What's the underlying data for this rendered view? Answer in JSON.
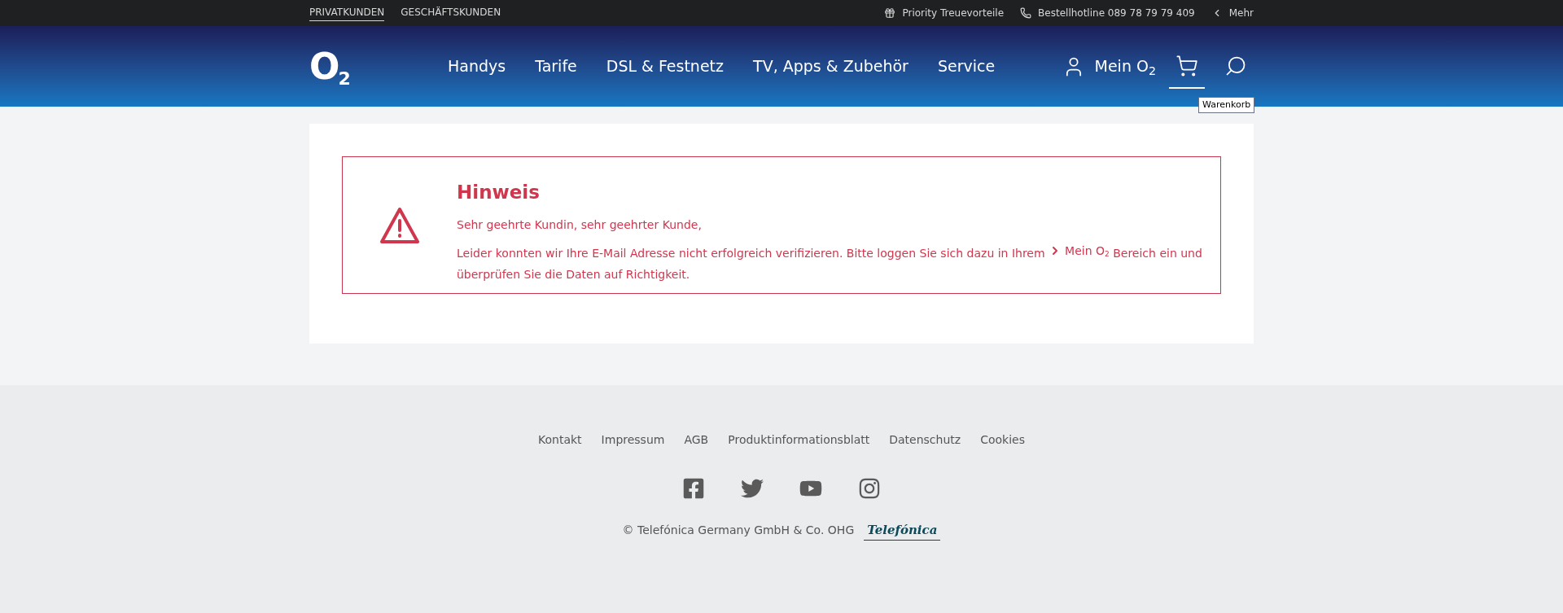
{
  "top_bar": {
    "segments": [
      {
        "label": "PRIVATKUNDEN",
        "selected": true
      },
      {
        "label": "GESCHÄFTSKUNDEN",
        "selected": false
      }
    ],
    "links": [
      {
        "kind": "priority",
        "label": "Priority Treuevorteile"
      },
      {
        "kind": "phone",
        "label": "Bestellhotline 089 78 79 79 409"
      },
      {
        "kind": "more",
        "label": "Mehr"
      }
    ]
  },
  "header": {
    "logo": {
      "letter": "O",
      "subscript": "2"
    },
    "nav": [
      "Handys",
      "Tarife",
      "DSL & Festnetz",
      "TV, Apps & Zubehör",
      "Service"
    ],
    "account": "Mein O$_{2}$",
    "actions": [
      {
        "kind": "cart",
        "selected": true,
        "tooltip": "Warenkorb"
      },
      {
        "kind": "search",
        "selected": false
      }
    ]
  },
  "notice": {
    "title": "Hinweis",
    "greeting": "Sehr geehrte Kundin, sehr geehrter Kunde,",
    "text_before": "Leider konnten wir Ihre E-Mail Adresse nicht erfolgreich verifizieren. Bitte loggen Sie sich dazu in Ihrem",
    "link": "Mein O$_{2}$",
    "text_after": "Bereich ein und überprüfen Sie die Daten auf Richtigkeit."
  },
  "footer": {
    "links": [
      "Kontakt",
      "Impressum",
      "AGB",
      "Produktinformationsblatt",
      "Datenschutz",
      "Cookies"
    ],
    "social": [
      {
        "kind": "facebook"
      },
      {
        "kind": "twitter"
      },
      {
        "kind": "youtube"
      },
      {
        "kind": "instagram"
      }
    ],
    "copyright": "© Telefónica Germany GmbH & Co. OHG",
    "brand": "Telefónica"
  }
}
